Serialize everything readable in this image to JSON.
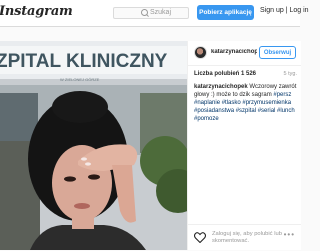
{
  "header": {
    "logo": "Instagram",
    "search_placeholder": "Szukaj",
    "app_button": "Pobierz aplikację",
    "signup": "Sign up",
    "separator": "|",
    "login": "Log in"
  },
  "photo": {
    "sign_text": "ZPITAL KLINICZNY",
    "sub_text": "W ZIELONEJ GÓRZE"
  },
  "post": {
    "username": "katarzynacichop...",
    "follow_button": "Obserwuj",
    "likes": "Liczba polubień 1 526",
    "time": "5 tyg.",
    "caption_user": "katarzynacichopek",
    "caption_text": "Wczorowy zawrót głowy :) może to dzik sagram",
    "caption_tags": "#persz #naplanie #tlasko #przymusemienka #posiadanstwa #szpital #serial #lunch #pomoze",
    "login_prompt": "Zaloguj się, aby polubić lub skomentować.",
    "more": "•••"
  }
}
